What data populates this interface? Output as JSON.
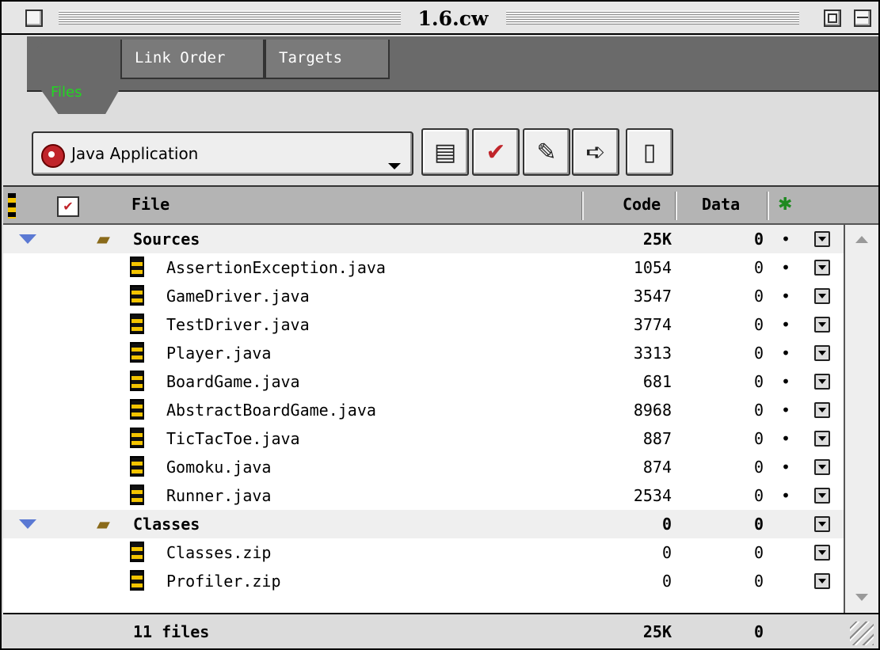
{
  "window": {
    "title": "1.6.cw"
  },
  "tabs": [
    {
      "label": "Files",
      "active": true
    },
    {
      "label": "Link Order",
      "active": false
    },
    {
      "label": "Targets",
      "active": false
    }
  ],
  "toolbar": {
    "target_popup": {
      "selected": "Java Application",
      "icon": "target-icon"
    },
    "buttons": [
      {
        "name": "file-settings-icon",
        "glyph": "▤"
      },
      {
        "name": "checkmark-icon",
        "glyph": "✔"
      },
      {
        "name": "make-icon",
        "glyph": "✎"
      },
      {
        "name": "arrow-right-icon",
        "glyph": "➪"
      },
      {
        "name": "document-icon",
        "glyph": "▯"
      }
    ]
  },
  "table": {
    "columns": {
      "file": "File",
      "code": "Code",
      "data": "Data"
    },
    "rows": [
      {
        "type": "group",
        "name": "Sources",
        "code": "25K",
        "data": "0",
        "debug": "•"
      },
      {
        "type": "file",
        "name": "AssertionException.java",
        "code": "1054",
        "data": "0",
        "debug": "•"
      },
      {
        "type": "file",
        "name": "GameDriver.java",
        "code": "3547",
        "data": "0",
        "debug": "•"
      },
      {
        "type": "file",
        "name": "TestDriver.java",
        "code": "3774",
        "data": "0",
        "debug": "•"
      },
      {
        "type": "file",
        "name": "Player.java",
        "code": "3313",
        "data": "0",
        "debug": "•"
      },
      {
        "type": "file",
        "name": "BoardGame.java",
        "code": "681",
        "data": "0",
        "debug": "•"
      },
      {
        "type": "file",
        "name": "AbstractBoardGame.java",
        "code": "8968",
        "data": "0",
        "debug": "•"
      },
      {
        "type": "file",
        "name": "TicTacToe.java",
        "code": "887",
        "data": "0",
        "debug": "•"
      },
      {
        "type": "file",
        "name": "Gomoku.java",
        "code": "874",
        "data": "0",
        "debug": "•"
      },
      {
        "type": "file",
        "name": "Runner.java",
        "code": "2534",
        "data": "0",
        "debug": "•"
      },
      {
        "type": "group",
        "name": "Classes",
        "code": "0",
        "data": "0",
        "debug": ""
      },
      {
        "type": "file",
        "name": "Classes.zip",
        "code": "0",
        "data": "0",
        "debug": ""
      },
      {
        "type": "file",
        "name": "Profiler.zip",
        "code": "0",
        "data": "0",
        "debug": ""
      }
    ]
  },
  "footer": {
    "count": "11 files",
    "code_total": "25K",
    "data_total": "0"
  },
  "colors": {
    "active_tab_text": "#22d722",
    "disclosure": "#5b79d3"
  }
}
